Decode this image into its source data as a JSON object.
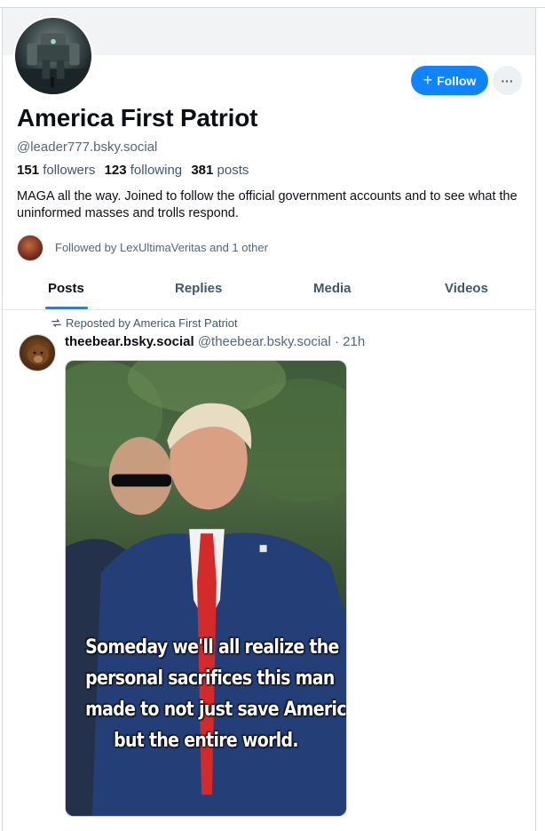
{
  "profile": {
    "display_name": "America First Patriot",
    "handle": "@leader777.bsky.social",
    "followers_count": "151",
    "followers_label": "followers",
    "following_count": "123",
    "following_label": "following",
    "posts_count": "381",
    "posts_label": "posts",
    "bio": "MAGA all the way.  Joined to follow the official government accounts and to see what the uninformed masses and trolls respond.",
    "followed_by": "Followed by LexUltimaVeritas and 1 other",
    "avatar_icon": "robot-mech-avatar-icon"
  },
  "actions": {
    "follow_label": "Follow",
    "follow_icon": "plus-icon",
    "more_label": "···"
  },
  "tabs": [
    {
      "label": "Posts",
      "active": true
    },
    {
      "label": "Replies",
      "active": false
    },
    {
      "label": "Media",
      "active": false
    },
    {
      "label": "Videos",
      "active": false
    }
  ],
  "post": {
    "repost_label": "Reposted by America First Patriot",
    "author_name": "theebear.bsky.social",
    "author_handle": "@theebear.bsky.social",
    "time": "· 21h",
    "image_caption": [
      "Someday we'll all realize the",
      "personal sacrifices this man",
      "made to not just save America",
      "but the entire world."
    ]
  },
  "colors": {
    "accent": "#1083fe",
    "muted_text": "#546677",
    "tab_inactive": "#42576c"
  }
}
